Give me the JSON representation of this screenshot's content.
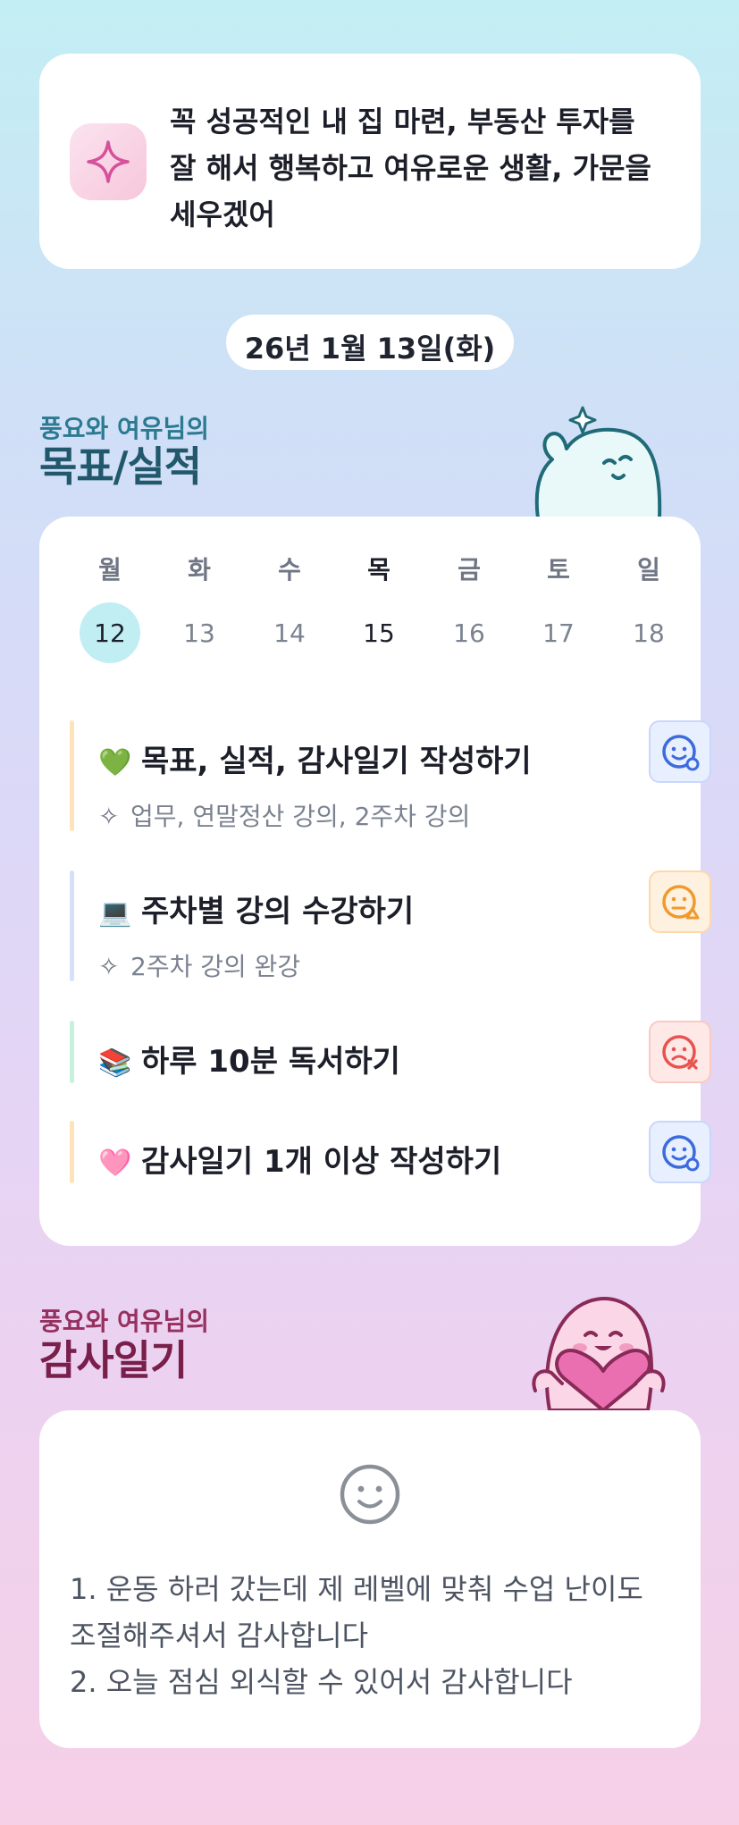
{
  "motto": {
    "icon": "sparkle-icon",
    "text": "꼭 성공적인 내 집 마련, 부동산 투자를 잘 해서 행복하고 여유로운 생활, 가문을 세우겠어"
  },
  "date_label": "26년 1월 13일(화)",
  "goals_section": {
    "subtitle": "풍요와 여유님의",
    "title": "목표/실적"
  },
  "week": [
    {
      "name": "월",
      "num": "12"
    },
    {
      "name": "화",
      "num": "13"
    },
    {
      "name": "수",
      "num": "14"
    },
    {
      "name": "목",
      "num": "15"
    },
    {
      "name": "금",
      "num": "16"
    },
    {
      "name": "토",
      "num": "17"
    },
    {
      "name": "일",
      "num": "18"
    }
  ],
  "goals": [
    {
      "emoji": "💚",
      "title": "목표, 실적, 감사일기 작성하기",
      "detail": "업무, 연말정산 강의, 2주차 강의",
      "status": "smile-blue-icon",
      "bar_color": "#fde3b9"
    },
    {
      "emoji": "💻",
      "title": "주차별 강의 수강하기",
      "detail": "2주차 강의 완강",
      "status": "neutral-orange-icon",
      "bar_color": "#d5e0fb"
    },
    {
      "emoji": "📚",
      "title": "하루 10분 독서하기",
      "detail": "",
      "status": "sad-red-icon",
      "bar_color": "#c8f1dd"
    },
    {
      "emoji": "🩷",
      "title": "감사일기 1개 이상 작성하기",
      "detail": "",
      "status": "smile-blue-icon",
      "bar_color": "#fde3b9"
    }
  ],
  "gratitude_section": {
    "subtitle": "풍요와 여유님의",
    "title": "감사일기"
  },
  "gratitude": {
    "icon": "smile-icon",
    "line1": "1. 운동 하러 갔는데 제 레벨에 맞춰 수업 난이도 조절해주셔서 감사합니다",
    "line2": "2. 오늘 점심 외식할 수 있어서 감사합니다"
  },
  "colors": {
    "primary_teal": "#21586b",
    "gratitude_magenta": "#7a1f4c",
    "selected_day": "#c1eef3",
    "status_blue": "#3b6bdc",
    "status_orange": "#ef9a2d",
    "status_red": "#e7534f"
  }
}
